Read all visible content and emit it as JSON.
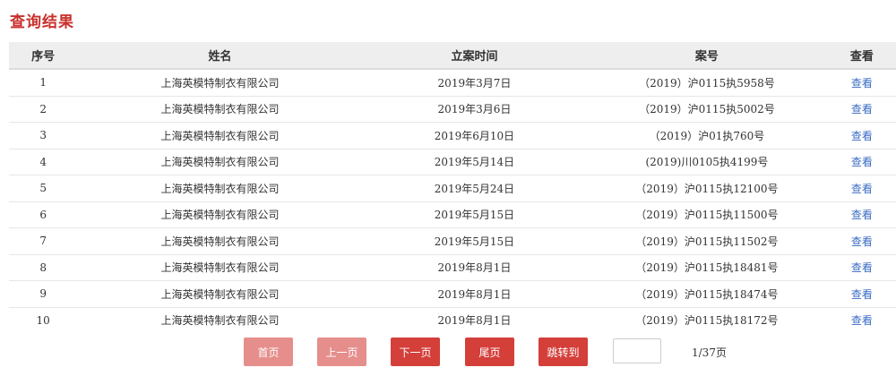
{
  "page": {
    "title": "查询结果"
  },
  "table": {
    "headers": {
      "index": "序号",
      "name": "姓名",
      "date": "立案时间",
      "case_no": "案号",
      "view": "查看"
    },
    "rows": [
      {
        "index": "1",
        "name": "上海英模特制衣有限公司",
        "date": "2019年3月7日",
        "case_no": "（2019）沪0115执5958号",
        "view": "查看"
      },
      {
        "index": "2",
        "name": "上海英模特制衣有限公司",
        "date": "2019年3月6日",
        "case_no": "（2019）沪0115执5002号",
        "view": "查看"
      },
      {
        "index": "3",
        "name": "上海英模特制衣有限公司",
        "date": "2019年6月10日",
        "case_no": "（2019）沪01执760号",
        "view": "查看"
      },
      {
        "index": "4",
        "name": "上海英模特制衣有限公司",
        "date": "2019年5月14日",
        "case_no": "(2019)川0105执4199号",
        "view": "查看"
      },
      {
        "index": "5",
        "name": "上海英模特制衣有限公司",
        "date": "2019年5月24日",
        "case_no": "（2019）沪0115执12100号",
        "view": "查看"
      },
      {
        "index": "6",
        "name": "上海英模特制衣有限公司",
        "date": "2019年5月15日",
        "case_no": "（2019）沪0115执11500号",
        "view": "查看"
      },
      {
        "index": "7",
        "name": "上海英模特制衣有限公司",
        "date": "2019年5月15日",
        "case_no": "（2019）沪0115执11502号",
        "view": "查看"
      },
      {
        "index": "8",
        "name": "上海英模特制衣有限公司",
        "date": "2019年8月1日",
        "case_no": "（2019）沪0115执18481号",
        "view": "查看"
      },
      {
        "index": "9",
        "name": "上海英模特制衣有限公司",
        "date": "2019年8月1日",
        "case_no": "（2019）沪0115执18474号",
        "view": "查看"
      },
      {
        "index": "10",
        "name": "上海英模特制衣有限公司",
        "date": "2019年8月1日",
        "case_no": "（2019）沪0115执18172号",
        "view": "查看"
      }
    ]
  },
  "pagination": {
    "first": "首页",
    "prev": "上一页",
    "next": "下一页",
    "last": "尾页",
    "jump": "跳转到",
    "jump_value": "",
    "page_info": "1/37页"
  },
  "colors": {
    "title": "#c9302c",
    "button_active": "#d43f3a",
    "button_disabled": "#e58e8c",
    "link": "#3b6cc4",
    "header_bg": "#eeeeee"
  }
}
